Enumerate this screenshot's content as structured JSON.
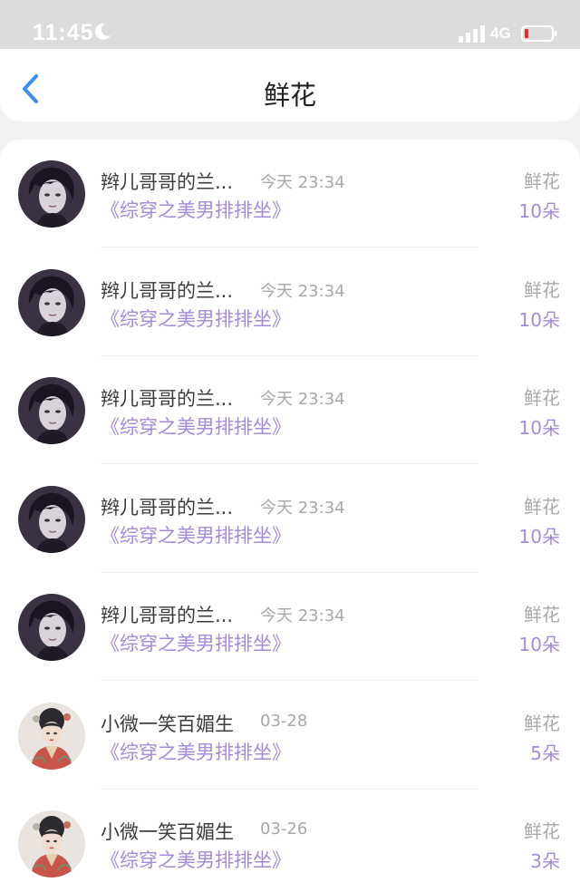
{
  "status_bar": {
    "time": "11:45",
    "network": "4G",
    "icons": [
      "moon-icon",
      "signal-icon",
      "battery-icon"
    ],
    "battery_color": "#e0302b"
  },
  "nav": {
    "title": "鲜花",
    "back_icon": "chevron-left-icon",
    "accent_color": "#3d8fe8"
  },
  "colors": {
    "name": "#3c3c3c",
    "meta": "#a8a8a8",
    "accent": "#a58bd5"
  },
  "records": [
    {
      "user": "辫儿哥哥的兰...",
      "time": "今天 23:34",
      "book": "《综穿之美男排排坐》",
      "gift": "鲜花",
      "count": "10朵",
      "avatar": "male-portrait"
    },
    {
      "user": "辫儿哥哥的兰...",
      "time": "今天 23:34",
      "book": "《综穿之美男排排坐》",
      "gift": "鲜花",
      "count": "10朵",
      "avatar": "male-portrait"
    },
    {
      "user": "辫儿哥哥的兰...",
      "time": "今天 23:34",
      "book": "《综穿之美男排排坐》",
      "gift": "鲜花",
      "count": "10朵",
      "avatar": "male-portrait"
    },
    {
      "user": "辫儿哥哥的兰...",
      "time": "今天 23:34",
      "book": "《综穿之美男排排坐》",
      "gift": "鲜花",
      "count": "10朵",
      "avatar": "male-portrait"
    },
    {
      "user": "辫儿哥哥的兰...",
      "time": "今天 23:34",
      "book": "《综穿之美男排排坐》",
      "gift": "鲜花",
      "count": "10朵",
      "avatar": "male-portrait"
    },
    {
      "user": "小微一笑百媚生",
      "time": "03-28",
      "book": "《综穿之美男排排坐》",
      "gift": "鲜花",
      "count": "5朵",
      "avatar": "costume-illustration"
    },
    {
      "user": "小微一笑百媚生",
      "time": "03-26",
      "book": "《综穿之美男排排坐》",
      "gift": "鲜花",
      "count": "3朵",
      "avatar": "costume-illustration"
    }
  ]
}
